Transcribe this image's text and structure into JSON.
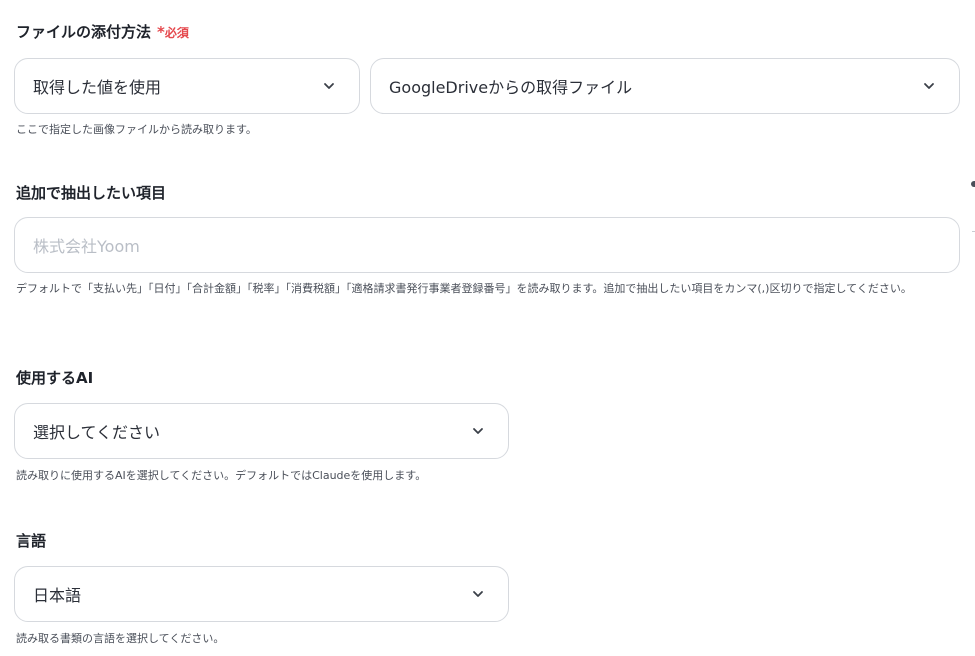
{
  "attachment": {
    "label": "ファイルの添付方法",
    "required_mark": "*",
    "required_text": "必須",
    "source_select": "取得した値を使用",
    "file_select": "GoogleDriveからの取得ファイル",
    "help": "ここで指定した画像ファイルから読み取ります。"
  },
  "extract": {
    "label": "追加で抽出したい項目",
    "placeholder": "株式会社Yoom",
    "help": "デフォルトで「支払い先」「日付」「合計金額」「税率」「消費税額」「適格請求書発行事業者登録番号」を読み取ります。追加で抽出したい項目をカンマ(,)区切りで指定してください。"
  },
  "ai": {
    "label": "使用するAI",
    "select": "選択してください",
    "help": "読み取りに使用するAIを選択してください。デフォルトではClaudeを使用します。"
  },
  "language": {
    "label": "言語",
    "select": "日本語",
    "help": "読み取る書類の言語を選択してください。"
  },
  "icons": {
    "dropdown": "chevron-down-icon"
  }
}
